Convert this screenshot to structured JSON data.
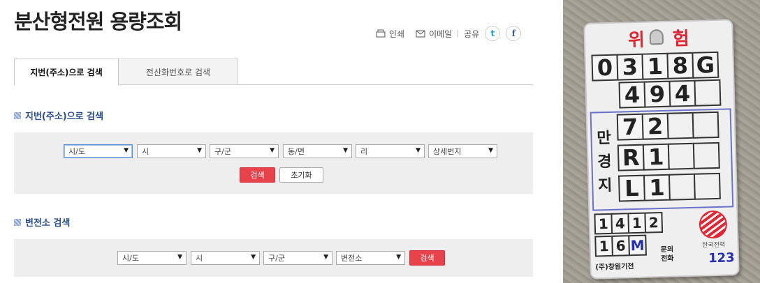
{
  "page": {
    "title": "분산형전원 용량조회"
  },
  "utility": {
    "print": "인쇄",
    "email": "이메일",
    "share": "공유",
    "twitter_letter": "t",
    "facebook_letter": "f"
  },
  "tabs": [
    {
      "label": "지번(주소)으로 검색",
      "active": true
    },
    {
      "label": "전산화번호로 검색",
      "active": false
    }
  ],
  "address_search": {
    "heading": "지번(주소)으로 검색",
    "selects": [
      "시/도",
      "시",
      "구/군",
      "동/면",
      "리",
      "상세번지"
    ],
    "search_button": "검색",
    "reset_button": "초기화"
  },
  "substation_search": {
    "heading": "변전소 검색",
    "selects": [
      "시/도",
      "시",
      "구/군",
      "변전소"
    ],
    "search_button": "검색"
  },
  "colors": {
    "accent_red": "#e8424b",
    "heading_blue": "#2a4d8f"
  },
  "photo": {
    "warning": "위험",
    "row1": [
      "0",
      "3",
      "1",
      "8",
      "G"
    ],
    "row2": [
      "4",
      "9",
      "4",
      ""
    ],
    "vertical_label": [
      "만",
      "경",
      "지"
    ],
    "grid_rows": [
      [
        "7",
        "2",
        "",
        ""
      ],
      [
        "R",
        "1",
        "",
        ""
      ],
      [
        "L",
        "1",
        "",
        ""
      ]
    ],
    "small_row1": [
      "1",
      "4",
      "1",
      "2"
    ],
    "small_row2": [
      "1",
      "6",
      "M"
    ],
    "company": "한국전력",
    "inquiry": "문의 전화",
    "phone": "123",
    "maker": "(주)창원기전"
  }
}
